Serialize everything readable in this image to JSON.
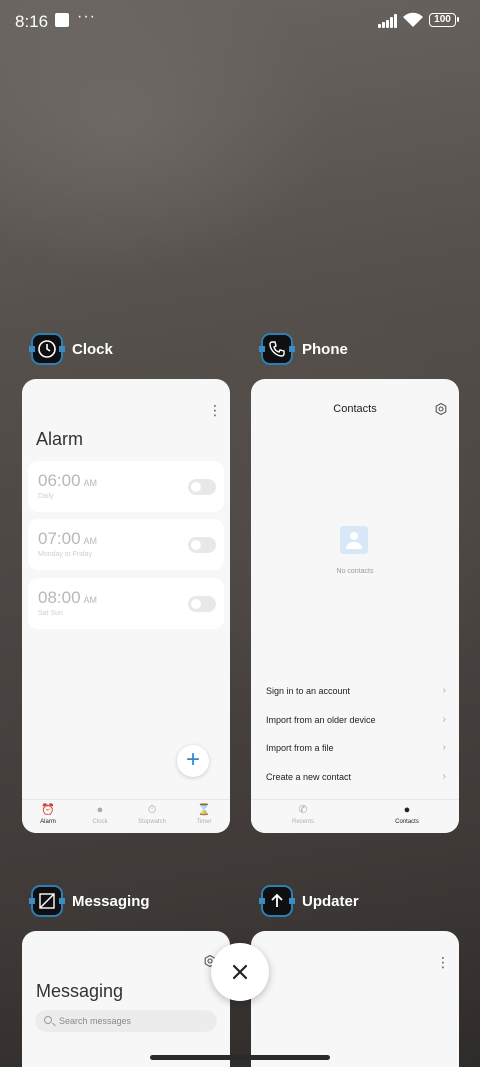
{
  "status_bar": {
    "time": "8:16",
    "more": "···",
    "battery": "100"
  },
  "apps": [
    {
      "name": "Clock",
      "icon": "clock-icon",
      "screen": {
        "title": "Alarm",
        "alarms": [
          {
            "time": "06:00",
            "ampm": "AM",
            "repeat": "Daily",
            "enabled": false
          },
          {
            "time": "07:00",
            "ampm": "AM",
            "repeat": "Monday to Friday",
            "enabled": false
          },
          {
            "time": "08:00",
            "ampm": "AM",
            "repeat": "Sat Sun",
            "enabled": false
          }
        ],
        "fab_label": "+",
        "tabs": [
          "Alarm",
          "Clock",
          "Stopwatch",
          "Timer"
        ],
        "active_tab": "Alarm"
      }
    },
    {
      "name": "Phone",
      "icon": "phone-icon",
      "screen": {
        "title": "Contacts",
        "empty_text": "No contacts",
        "actions": [
          "Sign in to an account",
          "Import from an older device",
          "Import from a file",
          "Create a new contact"
        ],
        "tabs": [
          "Recents",
          "Contacts"
        ],
        "active_tab": "Contacts"
      }
    },
    {
      "name": "Messaging",
      "icon": "messaging-icon",
      "screen": {
        "title": "Messaging",
        "search_placeholder": "Search messages"
      }
    },
    {
      "name": "Updater",
      "icon": "updater-icon",
      "screen": {}
    }
  ],
  "close_all_label": "×",
  "colors": {
    "accent": "#2f86d6",
    "icon_border": "#2d7fb2",
    "card_bg": "#f7f7f7"
  }
}
